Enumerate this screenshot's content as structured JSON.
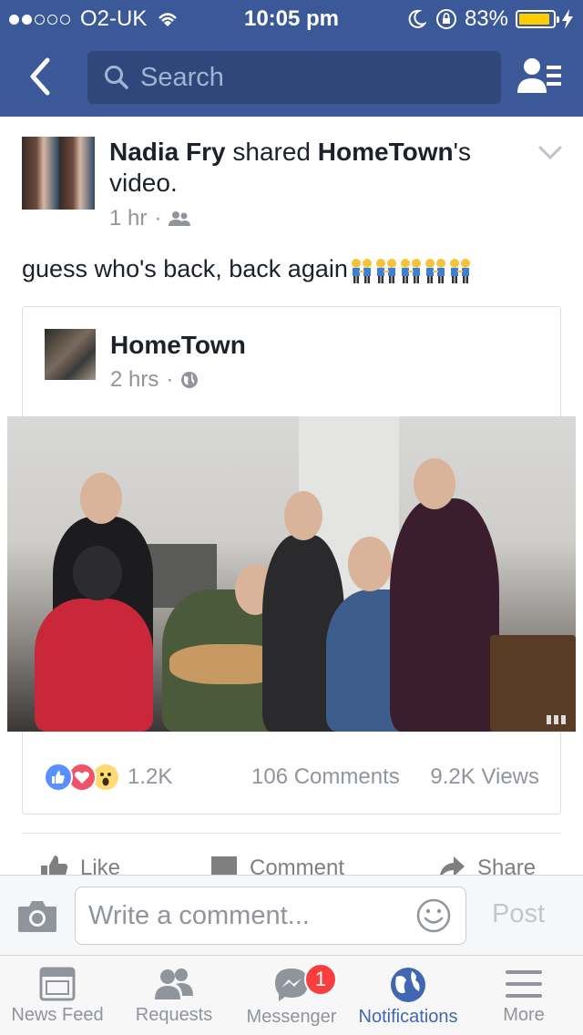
{
  "status_bar": {
    "carrier": "O2-UK",
    "time": "10:05 pm",
    "battery_percent": "83%",
    "battery_level": 0.83,
    "signal_bars_filled": 2,
    "signal_bars_total": 5
  },
  "nav": {
    "back_icon": "chevron-left-icon",
    "search_placeholder": "Search",
    "friends_icon": "friend-requests-icon",
    "background_color": "#3b5998"
  },
  "post": {
    "author": "Nadia Fry",
    "action_text": " shared ",
    "shared_page": "HomeTown",
    "suffix": "'s video.",
    "time": "1 hr",
    "audience_icon": "friends-icon",
    "text": "guess who's back, back again",
    "emoji_count": 5
  },
  "shared": {
    "page_name": "HomeTown",
    "time": "2 hrs",
    "audience_icon": "globe-icon"
  },
  "stats": {
    "reactions": [
      "like",
      "love",
      "wow"
    ],
    "reaction_count": "1.2K",
    "comments": "106 Comments",
    "views": "9.2K Views"
  },
  "actions": {
    "like": "Like",
    "comment": "Comment",
    "share": "Share"
  },
  "comment_bar": {
    "placeholder": "Write a comment...",
    "post_label": "Post"
  },
  "tabs": [
    {
      "label": "News Feed",
      "icon": "news-feed-icon",
      "active": false
    },
    {
      "label": "Requests",
      "icon": "requests-icon",
      "active": false
    },
    {
      "label": "Messenger",
      "icon": "messenger-icon",
      "active": false,
      "badge": "1"
    },
    {
      "label": "Notifications",
      "icon": "globe-icon",
      "active": true
    },
    {
      "label": "More",
      "icon": "menu-icon",
      "active": false
    }
  ],
  "colors": {
    "brand": "#3b5998",
    "active_tab": "#4267b2",
    "badge": "#fa3e3e"
  }
}
